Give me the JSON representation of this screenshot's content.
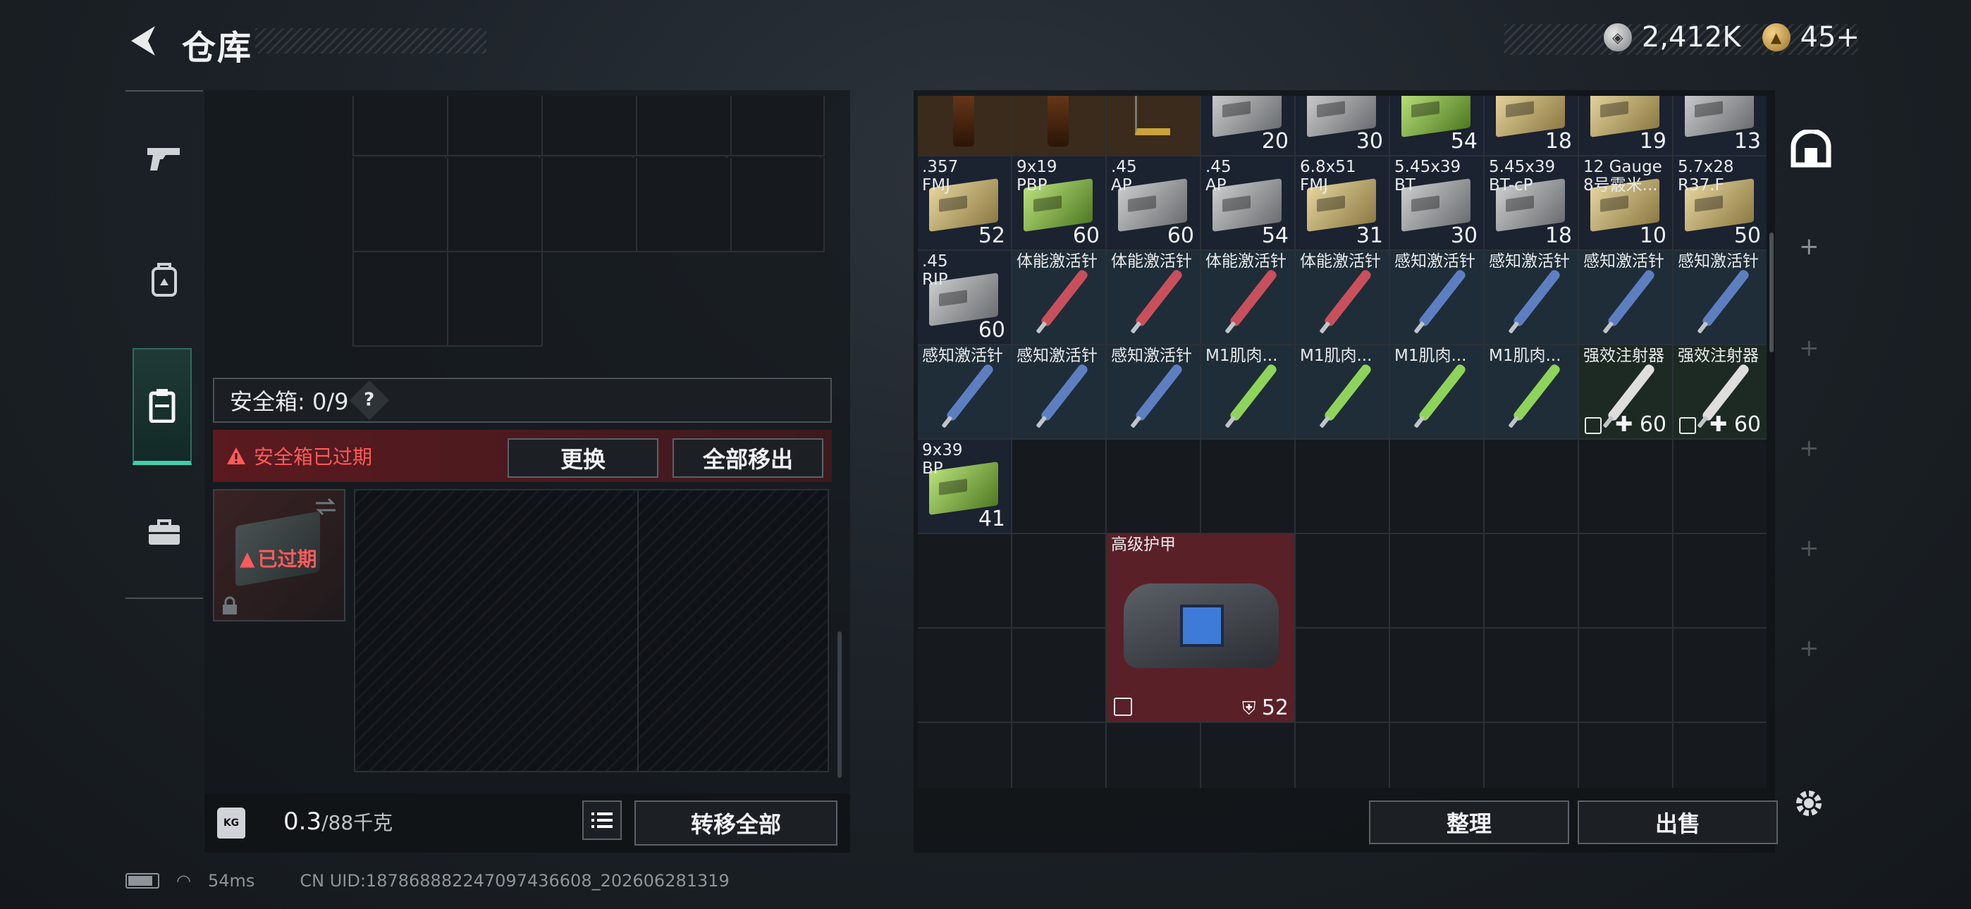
{
  "header": {
    "title": "仓库",
    "silver_amount": "2,412K",
    "gold_amount": "45+"
  },
  "left_rail": [
    {
      "id": "weapon",
      "icon": "pistol-icon"
    },
    {
      "id": "rig",
      "icon": "backpack-icon"
    },
    {
      "id": "case",
      "icon": "clipboard-icon",
      "active": true
    },
    {
      "id": "kit",
      "icon": "toolbox-icon"
    }
  ],
  "safe_box": {
    "title": "安全箱: 0/9",
    "help": "?",
    "expired_text": "安全箱已过期",
    "replace_label": "更换",
    "move_out_all_label": "全部移出",
    "case_status": "已过期"
  },
  "weight": {
    "value": "0.3",
    "max": "/88千克",
    "transfer_all_label": "转移全部"
  },
  "items": [
    {
      "label": "",
      "count": "",
      "kind": "bottle"
    },
    {
      "label": "",
      "count": "",
      "kind": "bottle"
    },
    {
      "label": "",
      "count": "",
      "kind": "scale"
    },
    {
      "label": "",
      "count": "20",
      "kind": "grey"
    },
    {
      "label": "",
      "count": "30",
      "kind": "grey"
    },
    {
      "label": "",
      "count": "54",
      "kind": "green"
    },
    {
      "label": "",
      "count": "18",
      "kind": "tan"
    },
    {
      "label": "",
      "count": "19",
      "kind": "tan"
    },
    {
      "label": "",
      "count": "13",
      "kind": "grey"
    },
    {
      "label": ".357\nFMJ",
      "count": "52",
      "kind": "tan"
    },
    {
      "label": "9x19\nPBP",
      "count": "60",
      "kind": "green"
    },
    {
      "label": ".45\nAP",
      "count": "60",
      "kind": "grey"
    },
    {
      "label": ".45\nAP",
      "count": "54",
      "kind": "grey"
    },
    {
      "label": "6.8x51\nFMJ",
      "count": "31",
      "kind": "tan"
    },
    {
      "label": "5.45x39\nBT",
      "count": "30",
      "kind": "grey"
    },
    {
      "label": "5.45x39\nBT-cP",
      "count": "18",
      "kind": "grey"
    },
    {
      "label": "12 Gauge\n8号霰米...",
      "count": "10",
      "kind": "tan"
    },
    {
      "label": "5.7x28\nR37.F",
      "count": "50",
      "kind": "tan"
    },
    {
      "label": ".45\nRIP",
      "count": "60",
      "kind": "grey"
    },
    {
      "label": "体能激活针",
      "count": "",
      "kind": "red"
    },
    {
      "label": "体能激活针",
      "count": "",
      "kind": "red"
    },
    {
      "label": "体能激活针",
      "count": "",
      "kind": "red"
    },
    {
      "label": "体能激活针",
      "count": "",
      "kind": "red"
    },
    {
      "label": "感知激活针",
      "count": "",
      "kind": "blue"
    },
    {
      "label": "感知激活针",
      "count": "",
      "kind": "blue"
    },
    {
      "label": "感知激活针",
      "count": "",
      "kind": "blue"
    },
    {
      "label": "感知激活针",
      "count": "",
      "kind": "blue"
    },
    {
      "label": "感知激活针",
      "count": "",
      "kind": "blue"
    },
    {
      "label": "感知激活针",
      "count": "",
      "kind": "blue"
    },
    {
      "label": "感知激活针",
      "count": "",
      "kind": "blue"
    },
    {
      "label": "M1肌肉...",
      "count": "",
      "kind": "lime"
    },
    {
      "label": "M1肌肉...",
      "count": "",
      "kind": "lime"
    },
    {
      "label": "M1肌肉...",
      "count": "",
      "kind": "lime"
    },
    {
      "label": "M1肌肉...",
      "count": "",
      "kind": "lime"
    },
    {
      "label": "强效注射器",
      "count": "✚ 60",
      "kind": "white"
    },
    {
      "label": "强效注射器",
      "count": "✚ 60",
      "kind": "white"
    },
    {
      "label": "9x39\nBP",
      "count": "41",
      "kind": "green"
    }
  ],
  "armor": {
    "label": "高级护甲",
    "durability": "52"
  },
  "actions": {
    "sort_label": "整理",
    "sell_label": "出售"
  },
  "footer": {
    "ping": "54ms",
    "uid": "CN UID:18786888224709743660­8_202606281319"
  }
}
